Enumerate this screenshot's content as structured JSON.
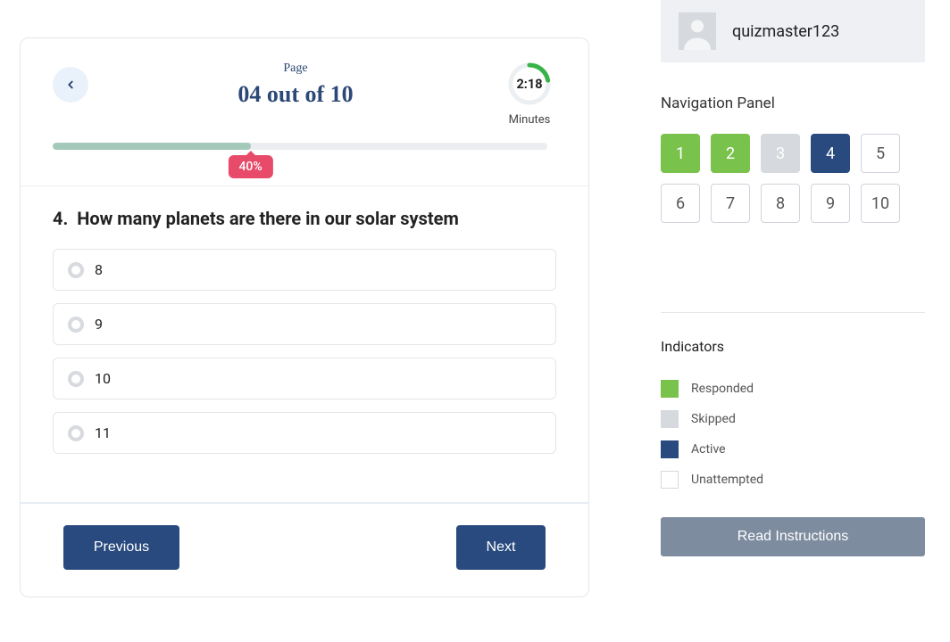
{
  "header": {
    "page_label": "Page",
    "page_count_text": "04 out of 10",
    "timer_value": "2:18",
    "timer_label": "Minutes",
    "timer_progress_pct": 22
  },
  "progress": {
    "percent": 40,
    "badge_text": "40%"
  },
  "question": {
    "number": "4.",
    "text": "How many planets are there in our solar system",
    "options": [
      "8",
      "9",
      "10",
      "11"
    ]
  },
  "buttons": {
    "previous": "Previous",
    "next": "Next",
    "read_instructions": "Read Instructions"
  },
  "user": {
    "name": "quizmaster123"
  },
  "nav": {
    "title": "Navigation Panel",
    "items": [
      {
        "n": "1",
        "state": "responded"
      },
      {
        "n": "2",
        "state": "responded"
      },
      {
        "n": "3",
        "state": "skipped"
      },
      {
        "n": "4",
        "state": "active"
      },
      {
        "n": "5",
        "state": "unattempted"
      },
      {
        "n": "6",
        "state": "unattempted"
      },
      {
        "n": "7",
        "state": "unattempted"
      },
      {
        "n": "8",
        "state": "unattempted"
      },
      {
        "n": "9",
        "state": "unattempted"
      },
      {
        "n": "10",
        "state": "unattempted"
      }
    ]
  },
  "indicators": {
    "title": "Indicators",
    "items": [
      {
        "label": "Responded",
        "color": "green"
      },
      {
        "label": "Skipped",
        "color": "grey"
      },
      {
        "label": "Active",
        "color": "navy"
      },
      {
        "label": "Unattempted",
        "color": "white"
      }
    ]
  }
}
